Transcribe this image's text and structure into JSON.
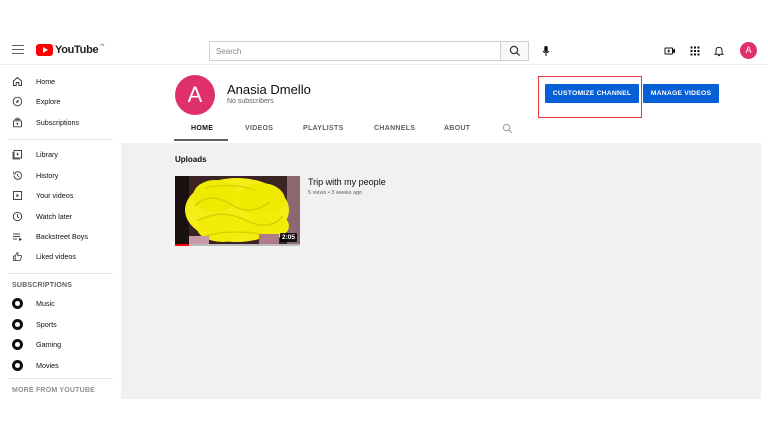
{
  "topbar": {
    "logo_text": "YouTube",
    "logo_region": "IN",
    "search_placeholder": "Search",
    "avatar_letter": "A"
  },
  "sidebar": {
    "main_items": [
      {
        "label": "Home",
        "icon": "home-icon"
      },
      {
        "label": "Explore",
        "icon": "compass-icon"
      },
      {
        "label": "Subscriptions",
        "icon": "subscriptions-icon"
      }
    ],
    "library_items": [
      {
        "label": "Library",
        "icon": "library-icon"
      },
      {
        "label": "History",
        "icon": "history-icon"
      },
      {
        "label": "Your videos",
        "icon": "your-videos-icon"
      },
      {
        "label": "Watch later",
        "icon": "clock-icon"
      },
      {
        "label": "Backstreet Boys",
        "icon": "playlist-icon"
      },
      {
        "label": "Liked videos",
        "icon": "thumbs-up-icon"
      }
    ],
    "subscriptions_heading": "SUBSCRIPTIONS",
    "subscriptions": [
      {
        "label": "Music"
      },
      {
        "label": "Sports"
      },
      {
        "label": "Gaming"
      },
      {
        "label": "Movies"
      }
    ],
    "more_heading": "MORE FROM YOUTUBE"
  },
  "channel": {
    "avatar_letter": "A",
    "name": "Anasia Dmello",
    "subscribers": "No subscribers",
    "customize_label": "CUSTOMIZE CHANNEL",
    "manage_label": "MANAGE VIDEOS",
    "tabs": [
      "HOME",
      "VIDEOS",
      "PLAYLISTS",
      "CHANNELS",
      "ABOUT"
    ],
    "active_tab": "HOME"
  },
  "uploads": {
    "heading": "Uploads",
    "video": {
      "title": "Trip with my people",
      "meta": "5 views • 3 weeks ago",
      "duration": "2:05"
    }
  },
  "colors": {
    "accent_blue": "#065fd4",
    "brand_red": "#ff0000",
    "avatar_pink": "#e0306a",
    "highlight_red": "#e53935"
  }
}
